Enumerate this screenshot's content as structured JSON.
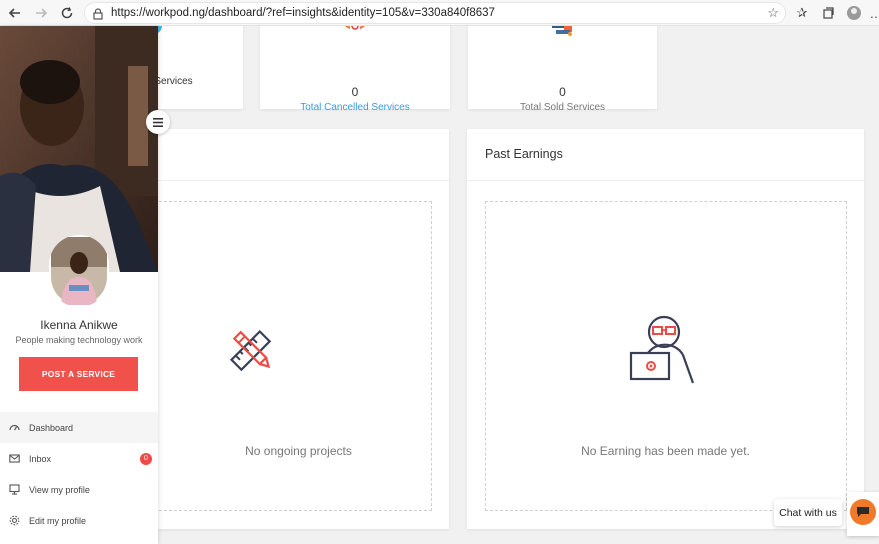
{
  "browser": {
    "url": "https://workpod.ng/dashboard/?ref=insights&identity=105&v=330a840f8637",
    "back_icon": "back-arrow-icon",
    "forward_icon": "forward-arrow-icon",
    "reload_icon": "reload-icon"
  },
  "stats": [
    {
      "value": "",
      "label": "d Services",
      "label_color": "#3c9bd6"
    },
    {
      "value": "0",
      "label": "Total Cancelled Services",
      "label_color": "#3c9bd6"
    },
    {
      "value": "0",
      "label": "Total Sold Services",
      "label_color": "#777777"
    }
  ],
  "panels": {
    "left": {
      "title": "",
      "empty_text": "No ongoing projects"
    },
    "right": {
      "title": "Past Earnings",
      "empty_text": "No Earning has been made yet."
    }
  },
  "sidebar": {
    "user_name": "Ikenna Anikwe",
    "tagline": "People making technology work",
    "post_button": "POST A SERVICE",
    "menu": [
      {
        "label": "Dashboard",
        "icon": "dashboard-gauge-icon",
        "active": true
      },
      {
        "label": "Inbox",
        "icon": "mail-icon",
        "badge": "0"
      },
      {
        "label": "View my profile",
        "icon": "monitor-icon"
      },
      {
        "label": "Edit my profile",
        "icon": "gear-icon"
      }
    ]
  },
  "chat": {
    "label": "Chat with us"
  },
  "colors": {
    "accent": "#f0524b",
    "link": "#3c9bd6",
    "chat": "#f07a2a"
  }
}
